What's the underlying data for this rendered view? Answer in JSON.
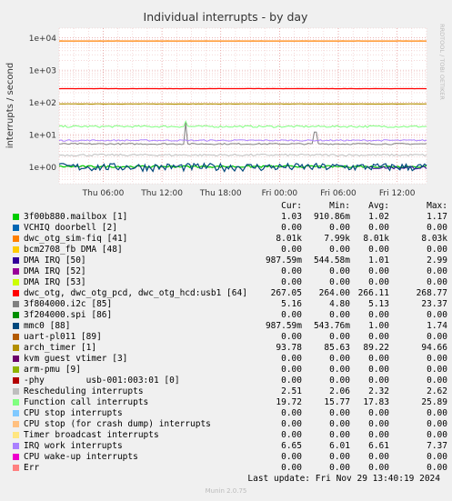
{
  "chart_data": {
    "type": "line",
    "title": "Individual interrupts - by day",
    "ylabel": "interrupts / second",
    "yscale": "log",
    "ylim": [
      0.3,
      20000
    ],
    "yticks": [
      "1e+04",
      "1e+03",
      "1e+02",
      "1e+01",
      "1e+00"
    ],
    "ytick_values": [
      10000,
      1000,
      100,
      10,
      1
    ],
    "xticks": [
      "Thu 06:00",
      "Thu 12:00",
      "Thu 18:00",
      "Fri 00:00",
      "Fri 06:00",
      "Fri 12:00"
    ],
    "xtick_hours": [
      6,
      12,
      18,
      24,
      30,
      36
    ],
    "xlim_hours": [
      1.5,
      39
    ],
    "side_label": "RRDTOOL / TOBI OETIKER",
    "grid": true,
    "columns": [
      "Cur:",
      "Min:",
      "Avg:",
      "Max:"
    ],
    "series": [
      {
        "name": "3f00b880.mailbox [1]",
        "color": "#00cc00",
        "values": [
          "1.03",
          "910.86m",
          "1.02",
          "1.17"
        ]
      },
      {
        "name": "VCHIQ doorbell [2]",
        "color": "#0066b3",
        "values": [
          "0.00",
          "0.00",
          "0.00",
          "0.00"
        ]
      },
      {
        "name": "dwc_otg_sim-fiq [41]",
        "color": "#ff8000",
        "values": [
          "8.01k",
          "7.99k",
          "8.01k",
          "8.03k"
        ]
      },
      {
        "name": "bcm2708_fb DMA [48]",
        "color": "#ffcc00",
        "values": [
          "0.00",
          "0.00",
          "0.00",
          "0.00"
        ]
      },
      {
        "name": "DMA IRQ [50]",
        "color": "#330099",
        "values": [
          "987.59m",
          "544.58m",
          "1.01",
          "2.99"
        ]
      },
      {
        "name": "DMA IRQ [52]",
        "color": "#990099",
        "values": [
          "0.00",
          "0.00",
          "0.00",
          "0.00"
        ]
      },
      {
        "name": "DMA IRQ [53]",
        "color": "#ccff00",
        "values": [
          "0.00",
          "0.00",
          "0.00",
          "0.00"
        ]
      },
      {
        "name": "dwc_otg, dwc_otg_pcd, dwc_otg_hcd:usb1 [64]",
        "color": "#ff0000",
        "values": [
          "267.05",
          "264.00",
          "266.11",
          "268.77"
        ]
      },
      {
        "name": "3f804000.i2c [85]",
        "color": "#808080",
        "values": [
          "5.16",
          "4.80",
          "5.13",
          "23.37"
        ]
      },
      {
        "name": "3f204000.spi [86]",
        "color": "#008f00",
        "values": [
          "0.00",
          "0.00",
          "0.00",
          "0.00"
        ]
      },
      {
        "name": "mmc0 [88]",
        "color": "#00487d",
        "values": [
          "987.59m",
          "543.76m",
          "1.00",
          "1.74"
        ]
      },
      {
        "name": "uart-pl011 [89]",
        "color": "#b35a00",
        "values": [
          "0.00",
          "0.00",
          "0.00",
          "0.00"
        ]
      },
      {
        "name": "arch_timer [1]",
        "color": "#b38f00",
        "values": [
          "93.78",
          "85.63",
          "89.22",
          "94.66"
        ]
      },
      {
        "name": "kvm guest vtimer [3]",
        "color": "#6b006b",
        "values": [
          "0.00",
          "0.00",
          "0.00",
          "0.00"
        ]
      },
      {
        "name": "arm-pmu [9]",
        "color": "#8fb300",
        "values": [
          "0.00",
          "0.00",
          "0.00",
          "0.00"
        ]
      },
      {
        "name": "-phy        usb-001:003:01 [0]",
        "color": "#b30000",
        "values": [
          "0.00",
          "0.00",
          "0.00",
          "0.00"
        ]
      },
      {
        "name": "Rescheduling interrupts",
        "color": "#bebebe",
        "values": [
          "2.51",
          "2.06",
          "2.32",
          "2.62"
        ]
      },
      {
        "name": "Function call interrupts",
        "color": "#80ff80",
        "values": [
          "19.72",
          "15.77",
          "17.83",
          "25.89"
        ]
      },
      {
        "name": "CPU stop interrupts",
        "color": "#80c9ff",
        "values": [
          "0.00",
          "0.00",
          "0.00",
          "0.00"
        ]
      },
      {
        "name": "CPU stop (for crash dump) interrupts",
        "color": "#ffc080",
        "values": [
          "0.00",
          "0.00",
          "0.00",
          "0.00"
        ]
      },
      {
        "name": "Timer broadcast interrupts",
        "color": "#ffe680",
        "values": [
          "0.00",
          "0.00",
          "0.00",
          "0.00"
        ]
      },
      {
        "name": "IRQ work interrupts",
        "color": "#aa80ff",
        "values": [
          "6.65",
          "6.01",
          "6.61",
          "7.37"
        ]
      },
      {
        "name": "CPU wake-up interrupts",
        "color": "#ee00cc",
        "values": [
          "0.00",
          "0.00",
          "0.00",
          "0.00"
        ]
      },
      {
        "name": "Err",
        "color": "#ff8080",
        "values": [
          "0.00",
          "0.00",
          "0.00",
          "0.00"
        ]
      }
    ]
  },
  "footer": {
    "last_update": "Last update: Fri Nov 29 13:40:19 2024",
    "munin": "Munin 2.0.75"
  }
}
